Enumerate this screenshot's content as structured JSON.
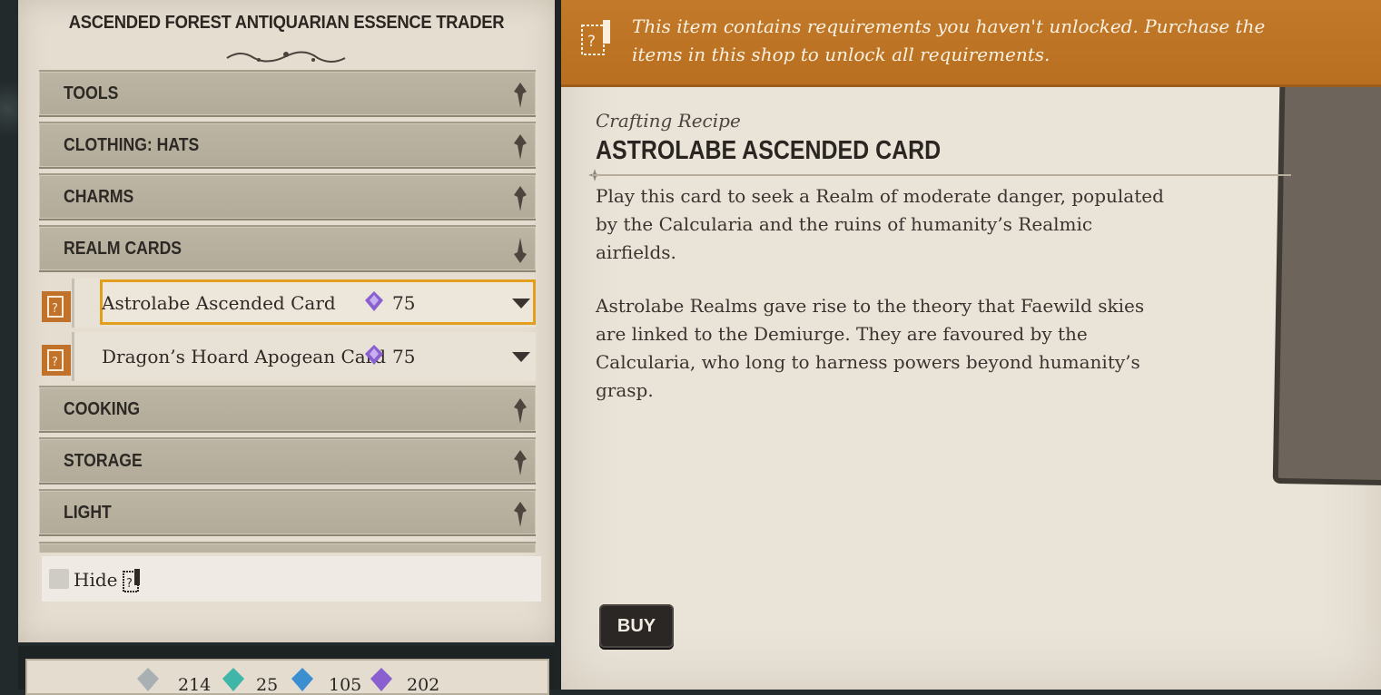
{
  "shop": {
    "title": "ASCENDED FOREST ANTIQUARIAN ESSENCE TRADER"
  },
  "categories_before": [
    {
      "label": "TOOLS",
      "icon": "chevron-down-icon"
    },
    {
      "label": "CLOTHING: HATS",
      "icon": "chevron-down-icon"
    },
    {
      "label": "CHARMS",
      "icon": "chevron-down-icon"
    },
    {
      "label": "REALM CARDS",
      "icon": "chevron-up-icon"
    }
  ],
  "items": [
    {
      "name": "Astrolabe Ascended Card",
      "price": "75",
      "currency_icon": "purple-essence-icon",
      "selected": true
    },
    {
      "name": "Dragon’s Hoard Apogean Card",
      "price": "75",
      "currency_icon": "purple-essence-icon",
      "selected": false
    }
  ],
  "categories_after": [
    {
      "label": "COOKING",
      "icon": "chevron-down-icon"
    },
    {
      "label": "STORAGE",
      "icon": "chevron-down-icon"
    },
    {
      "label": "LIGHT",
      "icon": "chevron-down-icon"
    }
  ],
  "hide_toggle": {
    "label": "Hide",
    "checked": false
  },
  "currencies": [
    {
      "icon": "grey-essence-icon",
      "amount": "214"
    },
    {
      "icon": "teal-essence-icon",
      "amount": "25"
    },
    {
      "icon": "blue-essence-icon",
      "amount": "105"
    },
    {
      "icon": "purple-essence-icon",
      "amount": "202"
    }
  ],
  "detail": {
    "banner": "This item contains requirements you haven't unlocked. Purchase the items in this shop to unlock all requirements.",
    "type": "Crafting Recipe",
    "title": "ASTROLABE ASCENDED CARD",
    "paragraph1": "Play this card to seek a Realm of moderate danger, populated by the Calcularia and the ruins of humanity’s Realmic airfields.",
    "paragraph2": "Astrolabe Realms gave rise to the theory that Faewild skies are linked to the Demiurge. They are favoured by the Calcularia, who long to harness powers beyond humanity’s grasp.",
    "buy_label": "BUY"
  },
  "colors": {
    "banner": "#c27a2a",
    "selection": "#e49e1e",
    "panel": "#e4ddd0",
    "category": "#b8b09f"
  }
}
